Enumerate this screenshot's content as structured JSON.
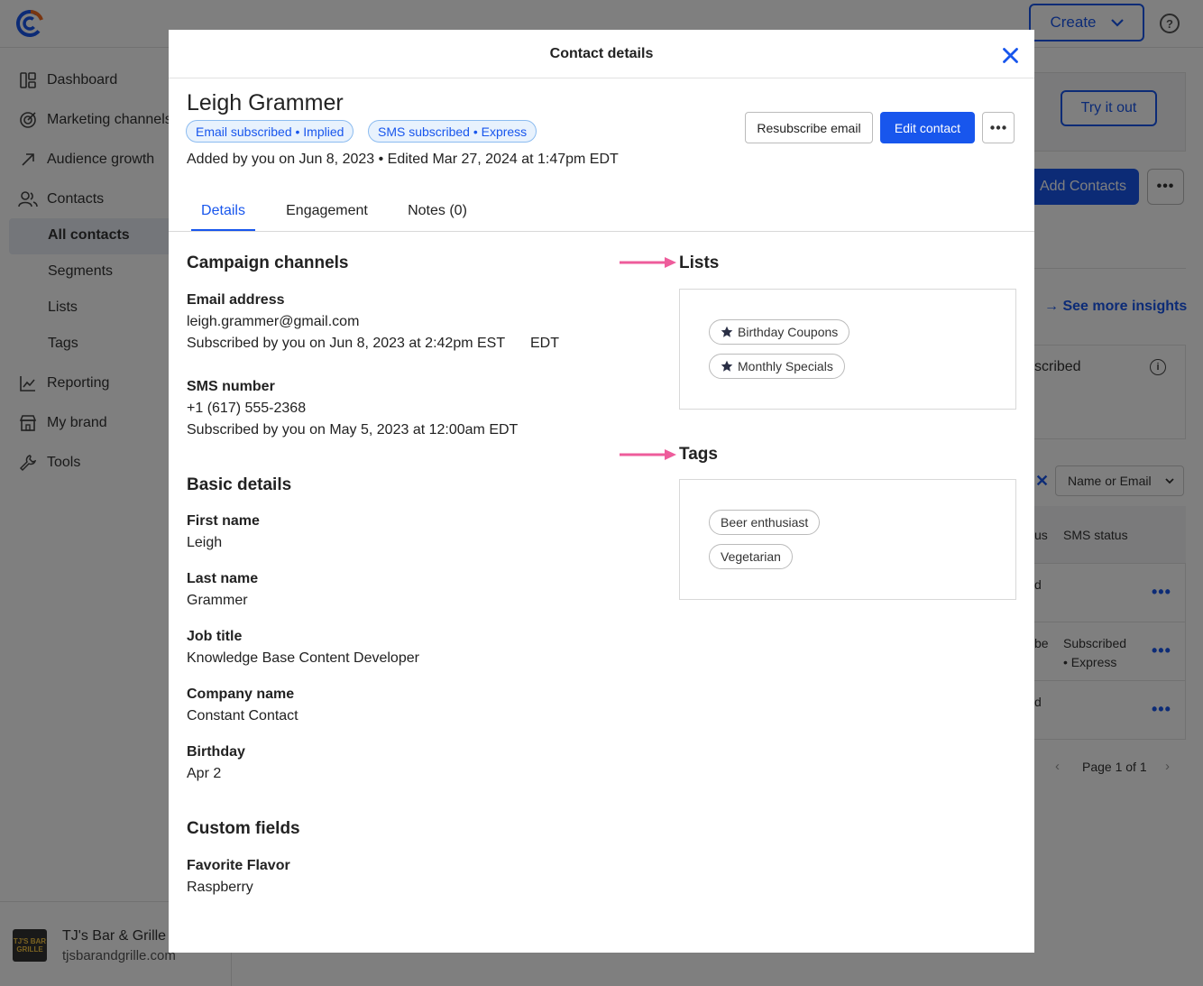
{
  "app": {
    "create_label": "Create",
    "help_label": "?",
    "nav": [
      {
        "label": "Dashboard",
        "icon": "dashboard-icon"
      },
      {
        "label": "Marketing channels",
        "icon": "target-icon"
      },
      {
        "label": "Audience growth",
        "icon": "trend-arrow-icon"
      },
      {
        "label": "Contacts",
        "icon": "people-icon"
      },
      {
        "label": "Reporting",
        "icon": "chart-icon"
      },
      {
        "label": "My brand",
        "icon": "storefront-icon"
      },
      {
        "label": "Tools",
        "icon": "wrench-icon"
      }
    ],
    "contacts_sub": [
      "All contacts",
      "Segments",
      "Lists",
      "Tags"
    ],
    "account": {
      "name": "TJ's Bar & Grille",
      "url": "tjsbarandgrille.com",
      "logo_text": "TJ'S BAR GRILLE"
    },
    "background": {
      "try_it_out": "Try it out",
      "add_contacts": "Add Contacts",
      "see_more_insights": "See more insights",
      "subscribed_partial": "scribed",
      "filter_label": "Name or Email",
      "col_partial": "us",
      "col_sms_status": "SMS status",
      "row1_partial": "d",
      "row2_partial": "be",
      "row2_sms_line1": "Subscribed",
      "row2_sms_line2": "• Express",
      "row3_partial": "d",
      "pagination": "Page 1 of 1"
    }
  },
  "modal": {
    "title": "Contact details",
    "contact_name": "Leigh Grammer",
    "badges": [
      "Email subscribed • Implied",
      "SMS subscribed • Express"
    ],
    "added_line": "Added by you on Jun 8, 2023 • Edited Mar 27, 2024 at 1:47pm EDT",
    "buttons": {
      "resubscribe": "Resubscribe email",
      "edit": "Edit contact"
    },
    "tabs": [
      "Details",
      "Engagement",
      "Notes (0)"
    ],
    "campaign": {
      "heading": "Campaign channels",
      "email_label": "Email address",
      "email_value": "leigh.grammer@gmail.com",
      "email_subscribed": "Subscribed by you on Jun 8, 2023 at 2:42pm EST",
      "email_tz": "EDT",
      "sms_label": "SMS number",
      "sms_value": "+1 (617) 555-2368",
      "sms_subscribed": "Subscribed by you on May 5, 2023 at 12:00am EDT"
    },
    "basic": {
      "heading": "Basic details",
      "fields": [
        {
          "label": "First name",
          "value": "Leigh"
        },
        {
          "label": "Last name",
          "value": "Grammer"
        },
        {
          "label": "Job title",
          "value": "Knowledge Base Content Developer"
        },
        {
          "label": "Company name",
          "value": "Constant Contact"
        },
        {
          "label": "Birthday",
          "value": "Apr 2"
        }
      ]
    },
    "custom": {
      "heading": "Custom fields",
      "fields": [
        {
          "label": "Favorite Flavor",
          "value": "Raspberry"
        }
      ]
    },
    "lists": {
      "heading": "Lists",
      "items": [
        "Birthday Coupons",
        "Monthly Specials"
      ]
    },
    "tags": {
      "heading": "Tags",
      "items": [
        "Beer enthusiast",
        "Vegetarian"
      ]
    }
  },
  "colors": {
    "accent": "#1856ed",
    "annotation_arrow": "#ee5c9b",
    "badge_bg": "#e8f2fd"
  }
}
